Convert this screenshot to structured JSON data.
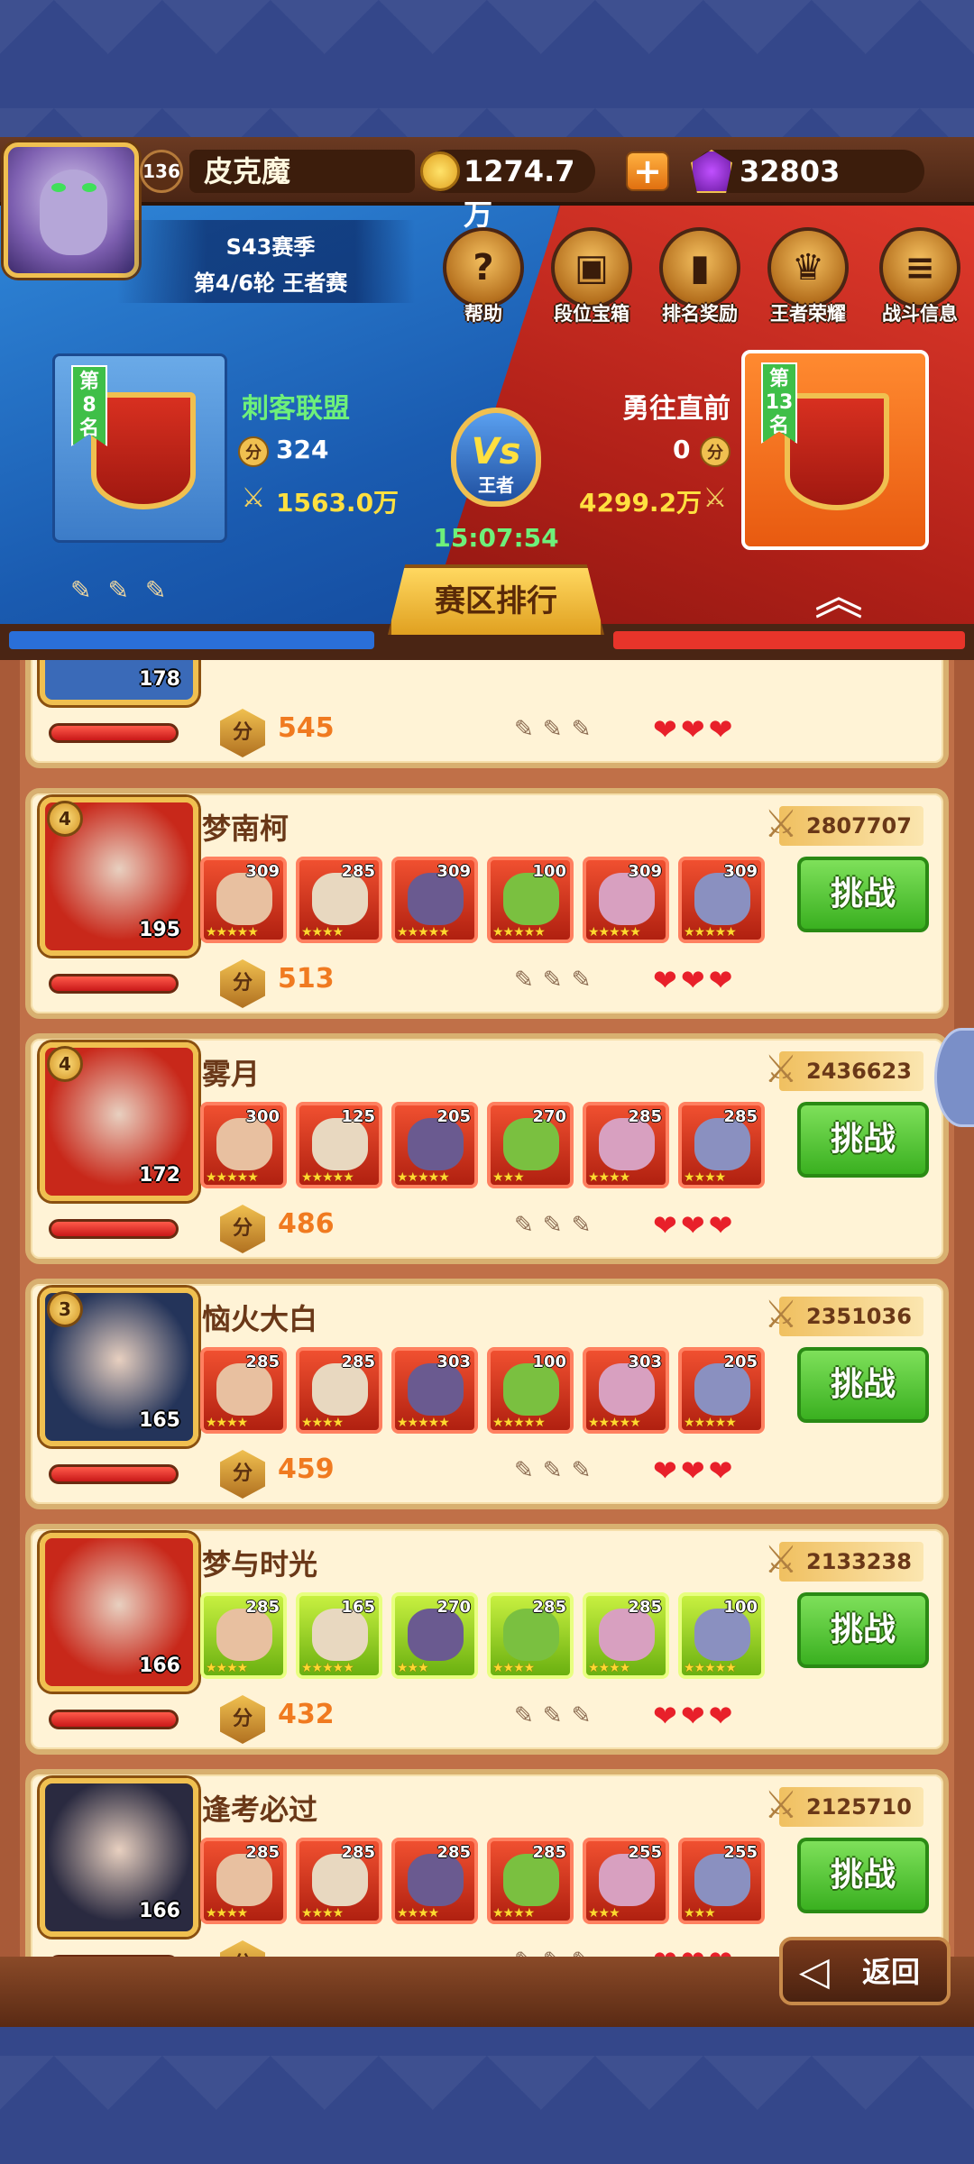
{
  "header": {
    "player": {
      "level": "136",
      "name": "皮克魔"
    },
    "gold": "1274.7万",
    "plus_label": "+",
    "gems": "32803",
    "season": {
      "title": "S43赛季",
      "round": "第4/6轮 王者赛"
    },
    "menu": [
      {
        "label": "帮助",
        "icon": "?"
      },
      {
        "label": "段位宝箱",
        "icon": "▣"
      },
      {
        "label": "排名奖励",
        "icon": "▮"
      },
      {
        "label": "王者荣耀",
        "icon": "♛"
      },
      {
        "label": "战斗信息",
        "icon": "≡"
      }
    ],
    "left_guild": {
      "rank_line1": "第",
      "rank_num": "8",
      "rank_line2": "名",
      "name": "刺客联盟",
      "score": "324",
      "power": "1563.0万"
    },
    "right_guild": {
      "rank_line1": "第",
      "rank_num": "13",
      "rank_line2": "名",
      "name": "勇往直前",
      "score": "0",
      "power": "4299.2万"
    },
    "vs": {
      "label": "Vs",
      "sub": "王者"
    },
    "timer": "15:07:54",
    "region_tab": "赛区排行",
    "score_icon": "分",
    "collapse_icon": "︽"
  },
  "list": {
    "partial_card": {
      "avatar_level": "178",
      "score": "545"
    },
    "cards": [
      {
        "rank": "4",
        "name": "梦南柯",
        "avatar_level": "195",
        "power": "2807707",
        "score": "513",
        "heroes": [
          {
            "lvl": "309",
            "stars": "★★★★★"
          },
          {
            "lvl": "285",
            "stars": "★★★★"
          },
          {
            "lvl": "309",
            "stars": "★★★★★"
          },
          {
            "lvl": "100",
            "stars": "★★★★★"
          },
          {
            "lvl": "309",
            "stars": "★★★★★"
          },
          {
            "lvl": "309",
            "stars": "★★★★★"
          }
        ],
        "avatar_color": "#c8281a"
      },
      {
        "rank": "4",
        "name": "雾月",
        "avatar_level": "172",
        "power": "2436623",
        "score": "486",
        "heroes": [
          {
            "lvl": "300",
            "stars": "★★★★★"
          },
          {
            "lvl": "125",
            "stars": "★★★★★"
          },
          {
            "lvl": "205",
            "stars": "★★★★★"
          },
          {
            "lvl": "270",
            "stars": "★★★"
          },
          {
            "lvl": "285",
            "stars": "★★★★"
          },
          {
            "lvl": "285",
            "stars": "★★★★"
          }
        ],
        "avatar_color": "#c8281a"
      },
      {
        "rank": "3",
        "name": "恼火大白",
        "avatar_level": "165",
        "power": "2351036",
        "score": "459",
        "heroes": [
          {
            "lvl": "285",
            "stars": "★★★★"
          },
          {
            "lvl": "285",
            "stars": "★★★★"
          },
          {
            "lvl": "303",
            "stars": "★★★★★"
          },
          {
            "lvl": "100",
            "stars": "★★★★★"
          },
          {
            "lvl": "303",
            "stars": "★★★★★"
          },
          {
            "lvl": "205",
            "stars": "★★★★★"
          }
        ],
        "avatar_color": "#24345a"
      },
      {
        "rank": "",
        "name": "梦与时光",
        "avatar_level": "166",
        "power": "2133238",
        "score": "432",
        "heroes": [
          {
            "lvl": "285",
            "stars": "★★★★"
          },
          {
            "lvl": "165",
            "stars": "★★★★★"
          },
          {
            "lvl": "270",
            "stars": "★★★"
          },
          {
            "lvl": "285",
            "stars": "★★★★"
          },
          {
            "lvl": "285",
            "stars": "★★★★"
          },
          {
            "lvl": "100",
            "stars": "★★★★★"
          }
        ],
        "avatar_color": "#c8281a"
      },
      {
        "rank": "",
        "name": "逢考必过",
        "avatar_level": "166",
        "power": "2125710",
        "score": "",
        "heroes": [
          {
            "lvl": "285",
            "stars": "★★★★"
          },
          {
            "lvl": "285",
            "stars": "★★★★"
          },
          {
            "lvl": "285",
            "stars": "★★★★"
          },
          {
            "lvl": "285",
            "stars": "★★★★"
          },
          {
            "lvl": "255",
            "stars": "★★★"
          },
          {
            "lvl": "255",
            "stars": "★★★"
          }
        ],
        "avatar_color": "#2a2a40"
      }
    ],
    "challenge_label": "挑战",
    "score_icon": "分",
    "hearts": "❤❤❤"
  },
  "footer": {
    "back_label": "返回"
  }
}
